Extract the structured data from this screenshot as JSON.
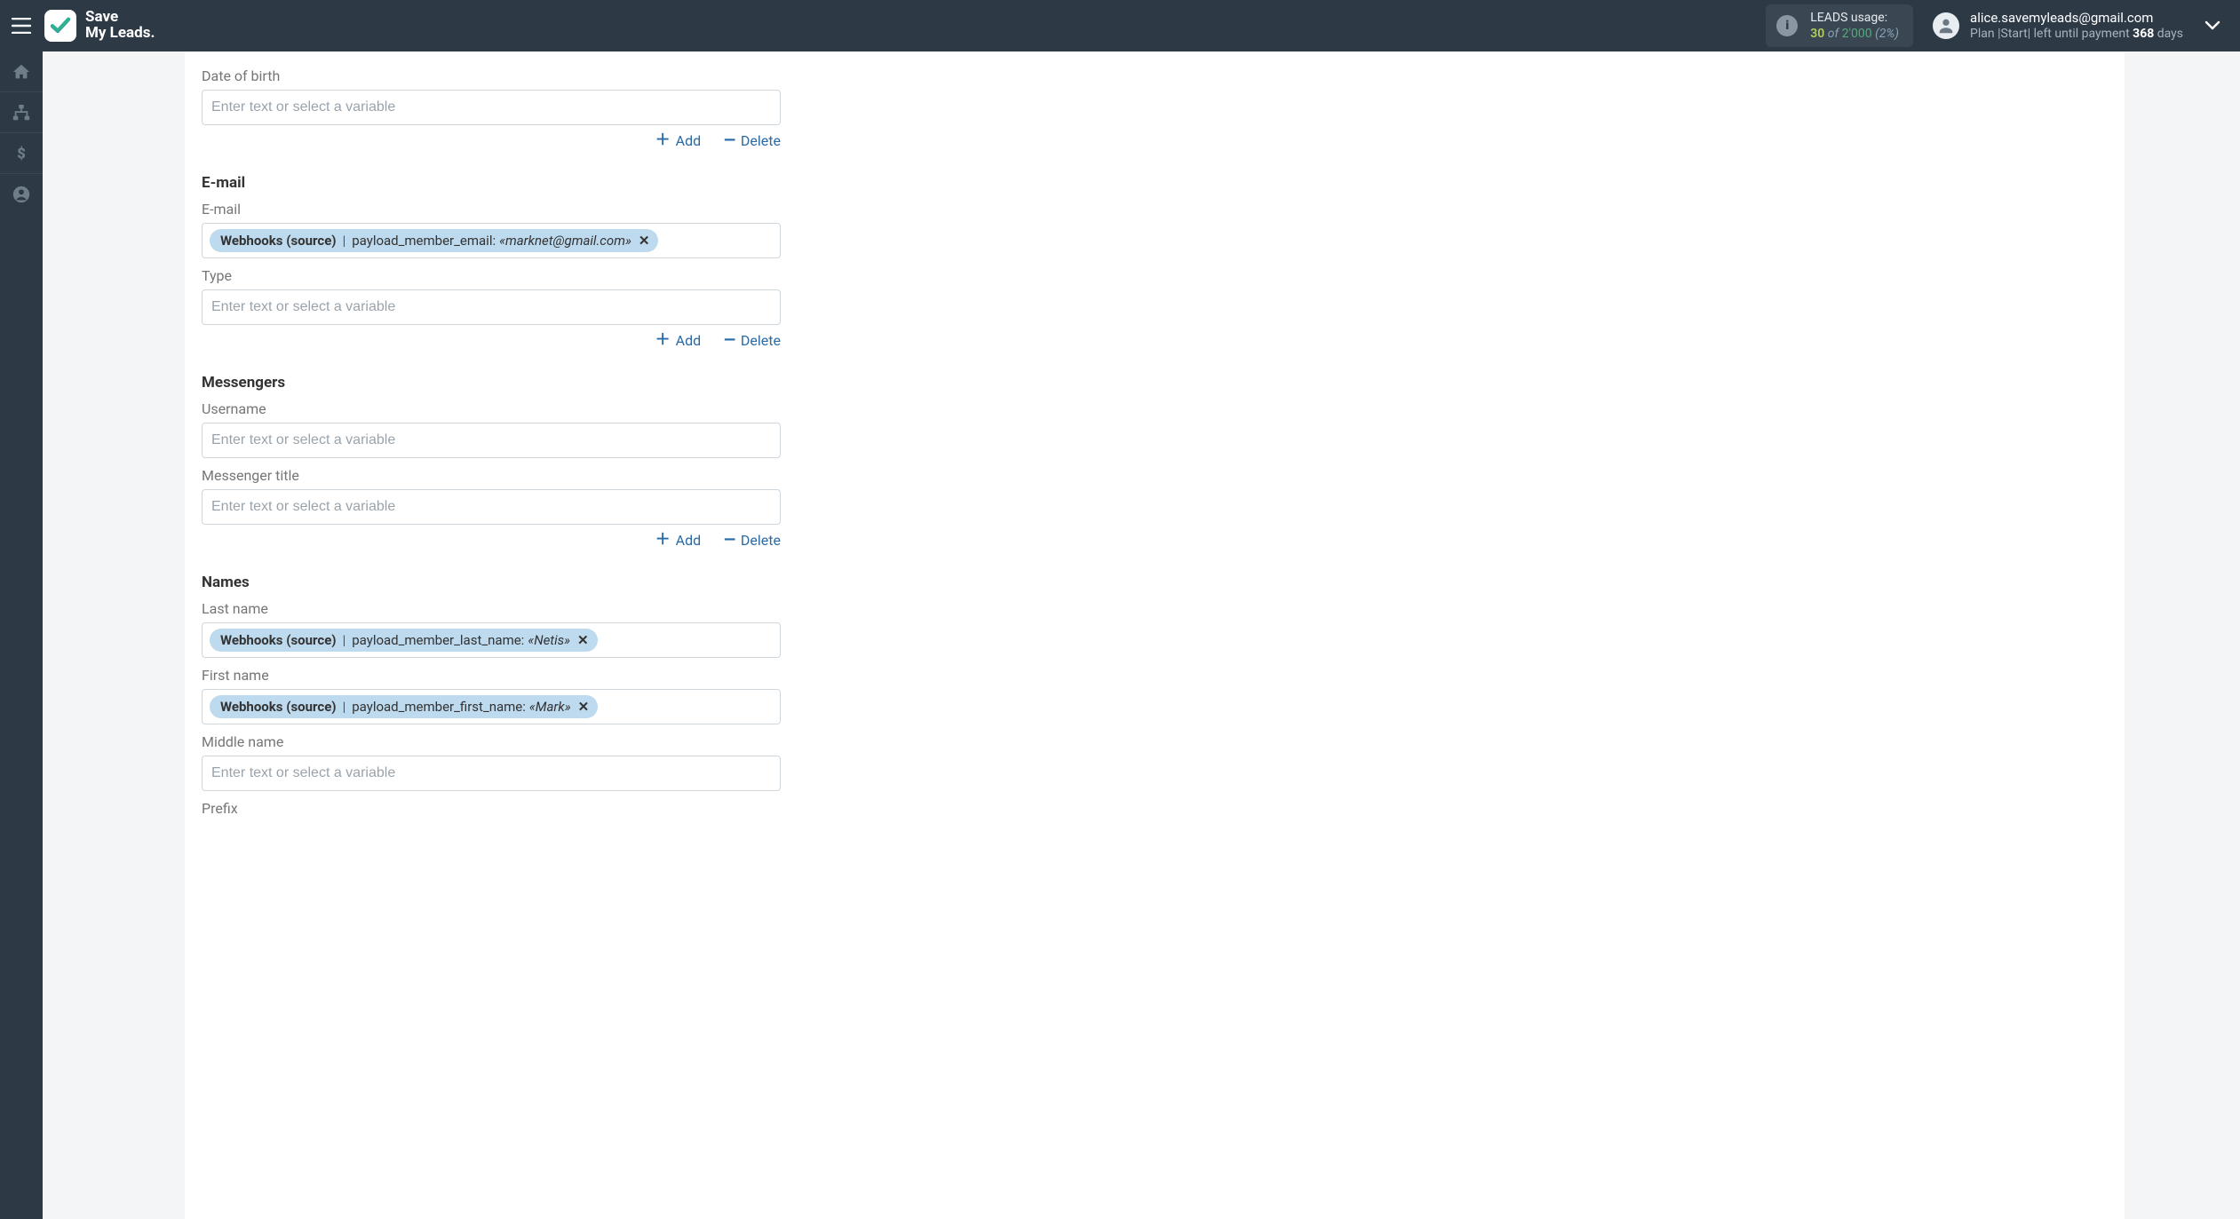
{
  "brand": {
    "line1": "Save",
    "line2": "My Leads."
  },
  "usage": {
    "title": "LEADS usage:",
    "used": "30",
    "of": "of",
    "total": "2'000",
    "pct": "(2%)"
  },
  "account": {
    "email": "alice.savemyleads@gmail.com",
    "plan_prefix": "Plan |",
    "plan_name": "Start",
    "plan_sep": "| left until payment ",
    "days": "368",
    "days_suffix": " days"
  },
  "actions": {
    "add": "Add",
    "delete": "Delete"
  },
  "placeholder": "Enter text or select a variable",
  "sections": {
    "email": "E-mail",
    "messengers": "Messengers",
    "names": "Names"
  },
  "fields": {
    "dob_label": "Date of birth",
    "email_label": "E-mail",
    "type_label": "Type",
    "username_label": "Username",
    "messenger_title_label": "Messenger title",
    "last_name_label": "Last name",
    "first_name_label": "First name",
    "middle_name_label": "Middle name",
    "prefix_label": "Prefix"
  },
  "chips": {
    "email": {
      "source": "Webhooks (source)",
      "key": "payload_member_email: ",
      "value": "«marknet@gmail.com»"
    },
    "last_name": {
      "source": "Webhooks (source)",
      "key": "payload_member_last_name: ",
      "value": "«Netis»"
    },
    "first_name": {
      "source": "Webhooks (source)",
      "key": "payload_member_first_name: ",
      "value": "«Mark»"
    }
  }
}
